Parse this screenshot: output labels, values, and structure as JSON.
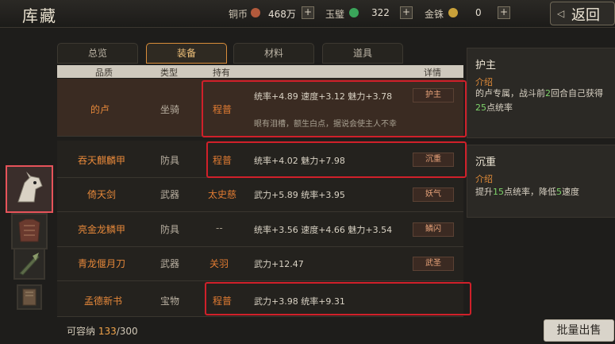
{
  "header": {
    "title": "库藏",
    "back_label": "返回",
    "back_arrow": "◁",
    "currencies": [
      {
        "label": "铜币",
        "value": "468万",
        "icon_color": "#b25a3c"
      },
      {
        "label": "玉璧",
        "value": "322",
        "icon_color": "#3aa55a"
      },
      {
        "label": "金铢",
        "value": "0",
        "icon_color": "#c9a13a"
      }
    ],
    "plus": "+"
  },
  "tabs": [
    {
      "label": "总览"
    },
    {
      "label": "装备"
    },
    {
      "label": "材料"
    },
    {
      "label": "道具"
    }
  ],
  "table": {
    "headers": {
      "quality": "品质",
      "type": "类型",
      "owner": "持有",
      "detail": "详情"
    },
    "rows": [
      {
        "name": "的卢",
        "type": "坐骑",
        "owner": "程普",
        "stats": "统率+4.89  速度+3.12  魅力+3.78",
        "desc": "眼有泪槽，额生白点，据说会使主人不幸",
        "tag": "护主"
      },
      {
        "name": "吞天麒麟甲",
        "type": "防具",
        "owner": "程普",
        "stats": "统率+4.02  魅力+7.98",
        "tag": "沉重"
      },
      {
        "name": "倚天剑",
        "type": "武器",
        "owner": "太史慈",
        "stats": "武力+5.89  统率+3.95",
        "tag": "妖气"
      },
      {
        "name": "亮金龙鳞甲",
        "type": "防具",
        "owner": "--",
        "stats": "统率+3.56  速度+4.66  魅力+3.54",
        "tag": "鳞闪"
      },
      {
        "name": "青龙偃月刀",
        "type": "武器",
        "owner": "关羽",
        "stats": "武力+12.47",
        "tag": "武圣"
      },
      {
        "name": "孟德新书",
        "type": "宝物",
        "owner": "程普",
        "stats": "武力+3.98  统率+9.31",
        "tag": ""
      }
    ]
  },
  "side_cards": [
    {
      "title": "护主",
      "label": "介绍",
      "text_parts": [
        "的卢专属，战斗前",
        "2",
        "回合自己获得",
        "25",
        "点统率"
      ]
    },
    {
      "title": "沉重",
      "label": "介绍",
      "text_parts": [
        "提升",
        "15",
        "点统率，降低",
        "5",
        "速度"
      ]
    }
  ],
  "footer": {
    "capacity_label": "可容纳 ",
    "capacity_current": "133",
    "capacity_sep_total": "/300",
    "sell_label": "批量出售"
  }
}
